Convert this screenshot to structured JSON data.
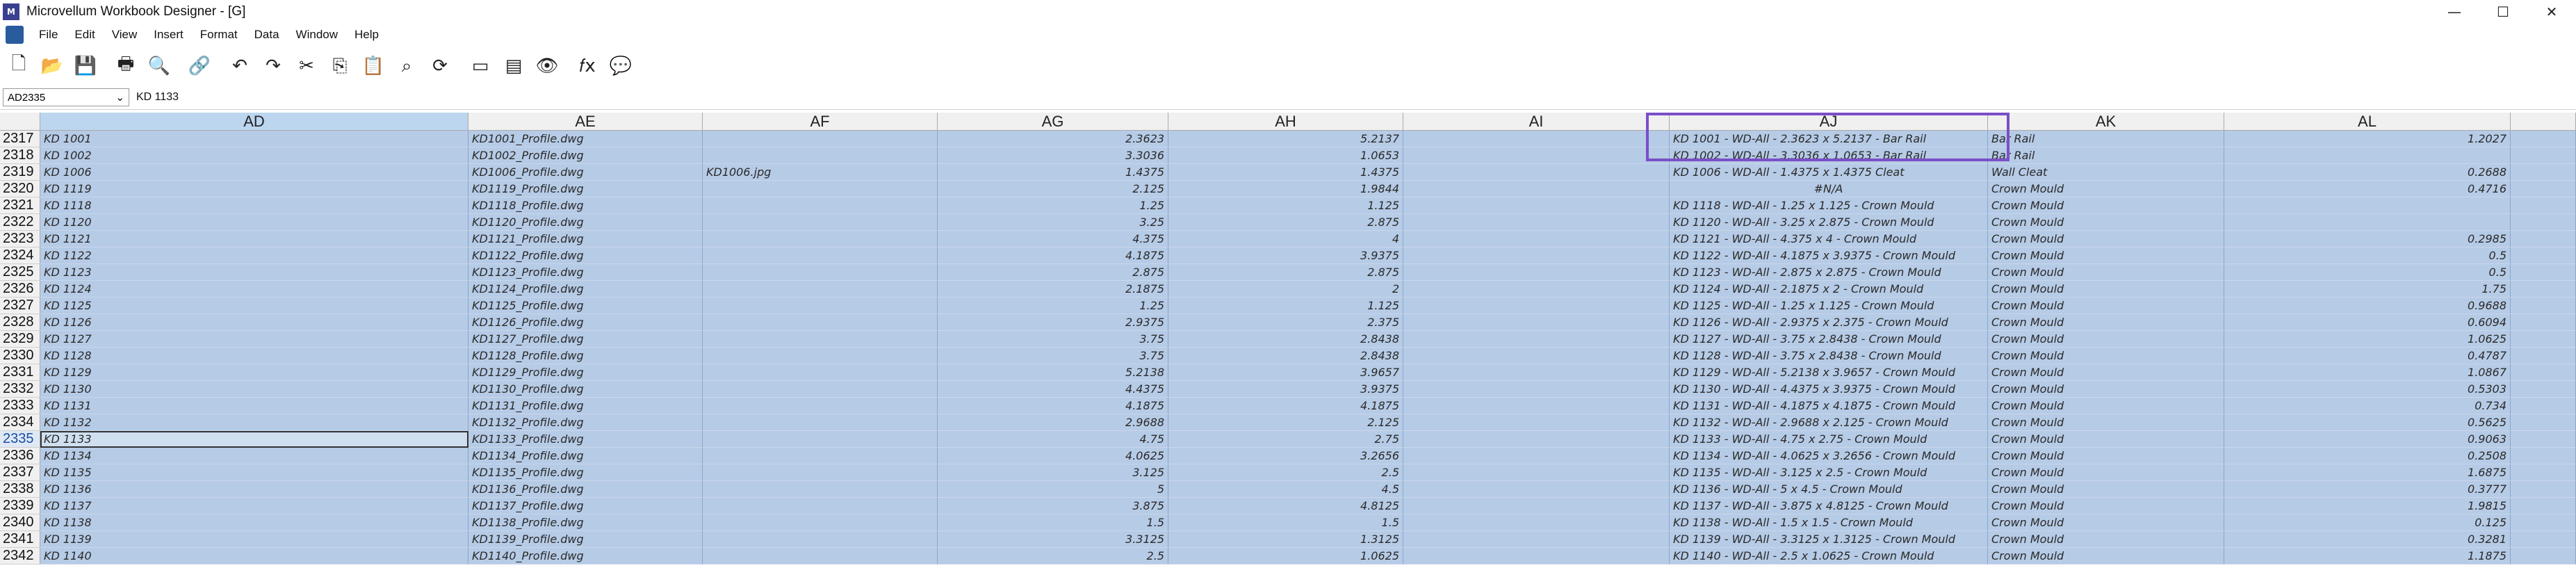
{
  "window": {
    "title": "Microvellum Workbook Designer - [G]",
    "minimize": "—",
    "maximize": "☐",
    "close": "✕"
  },
  "menu": [
    "File",
    "Edit",
    "View",
    "Insert",
    "Format",
    "Data",
    "Window",
    "Help"
  ],
  "toolbar": {
    "icons": [
      "new-file-icon",
      "open-folder-icon",
      "save-icon",
      "print-icon",
      "print-preview-icon",
      "link-icon",
      "undo-icon",
      "redo-icon",
      "cut-icon",
      "copy-icon",
      "paste-icon",
      "find-icon",
      "refresh-icon",
      "window-icon",
      "layout-icon",
      "eye-icon",
      "function-icon",
      "comment-icon"
    ],
    "glyphs": [
      "🗋",
      "📂",
      "💾",
      "🖶",
      "🔍",
      "🔗",
      "↶",
      "↷",
      "✂",
      "⎘",
      "📋",
      "⌕",
      "⟳",
      "▭",
      "▤",
      "👁",
      "𝑓x",
      "💬"
    ]
  },
  "formula_bar": {
    "name_box": "AD2335",
    "dropdown": "⌄",
    "value": "KD 1133"
  },
  "columns": [
    "AD",
    "AE",
    "AF",
    "AG",
    "AH",
    "AI",
    "AJ",
    "AK",
    "AL",
    ""
  ],
  "selected_column": "AD",
  "active_row": "2335",
  "rows": [
    {
      "n": "2317",
      "AD": "KD 1001",
      "AE": "KD1001_Profile.dwg",
      "AF": "",
      "AG": "2.3623",
      "AH": "5.2137",
      "AI": "",
      "AJ": "KD 1001 - WD-All - 2.3623 x 5.2137 - Bar Rail",
      "AK": "Bar Rail",
      "AL": "1.2027"
    },
    {
      "n": "2318",
      "AD": "KD 1002",
      "AE": "KD1002_Profile.dwg",
      "AF": "",
      "AG": "3.3036",
      "AH": "1.0653",
      "AI": "",
      "AJ": "KD 1002 - WD-All - 3.3036 x 1.0653 - Bar Rail",
      "AK": "Bar Rail",
      "AL": ""
    },
    {
      "n": "2319",
      "AD": "KD 1006",
      "AE": "KD1006_Profile.dwg",
      "AF": "KD1006.jpg",
      "AG": "1.4375",
      "AH": "1.4375",
      "AI": "",
      "AJ": "KD 1006 - WD-All - 1.4375 x 1.4375 Cleat",
      "AK": "Wall Cleat",
      "AL": "0.2688"
    },
    {
      "n": "2320",
      "AD": "KD 1119",
      "AE": "KD1119_Profile.dwg",
      "AF": "",
      "AG": "2.125",
      "AH": "1.9844",
      "AI": "",
      "AJ": "#N/A",
      "AK": "Crown Mould",
      "AL": "0.4716"
    },
    {
      "n": "2321",
      "AD": "KD 1118",
      "AE": "KD1118_Profile.dwg",
      "AF": "",
      "AG": "1.25",
      "AH": "1.125",
      "AI": "",
      "AJ": "KD 1118 - WD-All - 1.25 x 1.125 - Crown Mould",
      "AK": "Crown Mould",
      "AL": ""
    },
    {
      "n": "2322",
      "AD": "KD 1120",
      "AE": "KD1120_Profile.dwg",
      "AF": "",
      "AG": "3.25",
      "AH": "2.875",
      "AI": "",
      "AJ": "KD 1120 - WD-All - 3.25 x 2.875 - Crown Mould",
      "AK": "Crown Mould",
      "AL": ""
    },
    {
      "n": "2323",
      "AD": "KD 1121",
      "AE": "KD1121_Profile.dwg",
      "AF": "",
      "AG": "4.375",
      "AH": "4",
      "AI": "",
      "AJ": "KD 1121 - WD-All - 4.375 x 4 - Crown Mould",
      "AK": "Crown Mould",
      "AL": "0.2985"
    },
    {
      "n": "2324",
      "AD": "KD 1122",
      "AE": "KD1122_Profile.dwg",
      "AF": "",
      "AG": "4.1875",
      "AH": "3.9375",
      "AI": "",
      "AJ": "KD 1122 - WD-All - 4.1875 x 3.9375 - Crown Mould",
      "AK": "Crown Mould",
      "AL": "0.5"
    },
    {
      "n": "2325",
      "AD": "KD 1123",
      "AE": "KD1123_Profile.dwg",
      "AF": "",
      "AG": "2.875",
      "AH": "2.875",
      "AI": "",
      "AJ": "KD 1123 - WD-All - 2.875 x 2.875 - Crown Mould",
      "AK": "Crown Mould",
      "AL": "0.5"
    },
    {
      "n": "2326",
      "AD": "KD 1124",
      "AE": "KD1124_Profile.dwg",
      "AF": "",
      "AG": "2.1875",
      "AH": "2",
      "AI": "",
      "AJ": "KD 1124 - WD-All - 2.1875 x 2 - Crown Mould",
      "AK": "Crown Mould",
      "AL": "1.75"
    },
    {
      "n": "2327",
      "AD": "KD 1125",
      "AE": "KD1125_Profile.dwg",
      "AF": "",
      "AG": "1.25",
      "AH": "1.125",
      "AI": "",
      "AJ": "KD 1125 - WD-All - 1.25 x 1.125 - Crown Mould",
      "AK": "Crown Mould",
      "AL": "0.9688"
    },
    {
      "n": "2328",
      "AD": "KD 1126",
      "AE": "KD1126_Profile.dwg",
      "AF": "",
      "AG": "2.9375",
      "AH": "2.375",
      "AI": "",
      "AJ": "KD 1126 - WD-All - 2.9375 x 2.375 - Crown Mould",
      "AK": "Crown Mould",
      "AL": "0.6094"
    },
    {
      "n": "2329",
      "AD": "KD 1127",
      "AE": "KD1127_Profile.dwg",
      "AF": "",
      "AG": "3.75",
      "AH": "2.8438",
      "AI": "",
      "AJ": "KD 1127 - WD-All - 3.75 x 2.8438 - Crown Mould",
      "AK": "Crown Mould",
      "AL": "1.0625"
    },
    {
      "n": "2330",
      "AD": "KD 1128",
      "AE": "KD1128_Profile.dwg",
      "AF": "",
      "AG": "3.75",
      "AH": "2.8438",
      "AI": "",
      "AJ": "KD 1128 - WD-All - 3.75 x 2.8438 - Crown Mould",
      "AK": "Crown Mould",
      "AL": "0.4787"
    },
    {
      "n": "2331",
      "AD": "KD 1129",
      "AE": "KD1129_Profile.dwg",
      "AF": "",
      "AG": "5.2138",
      "AH": "3.9657",
      "AI": "",
      "AJ": "KD 1129 - WD-All - 5.2138 x 3.9657 - Crown Mould",
      "AK": "Crown Mould",
      "AL": "1.0867"
    },
    {
      "n": "2332",
      "AD": "KD 1130",
      "AE": "KD1130_Profile.dwg",
      "AF": "",
      "AG": "4.4375",
      "AH": "3.9375",
      "AI": "",
      "AJ": "KD 1130 - WD-All - 4.4375 x 3.9375 - Crown Mould",
      "AK": "Crown Mould",
      "AL": "0.5303"
    },
    {
      "n": "2333",
      "AD": "KD 1131",
      "AE": "KD1131_Profile.dwg",
      "AF": "",
      "AG": "4.1875",
      "AH": "4.1875",
      "AI": "",
      "AJ": "KD 1131 - WD-All - 4.1875 x 4.1875 - Crown Mould",
      "AK": "Crown Mould",
      "AL": "0.734"
    },
    {
      "n": "2334",
      "AD": "KD 1132",
      "AE": "KD1132_Profile.dwg",
      "AF": "",
      "AG": "2.9688",
      "AH": "2.125",
      "AI": "",
      "AJ": "KD 1132 - WD-All - 2.9688 x 2.125 - Crown Mould",
      "AK": "Crown Mould",
      "AL": "0.5625"
    },
    {
      "n": "2335",
      "AD": "KD 1133",
      "AE": "KD1133_Profile.dwg",
      "AF": "",
      "AG": "4.75",
      "AH": "2.75",
      "AI": "",
      "AJ": "KD 1133 - WD-All - 4.75 x 2.75 - Crown Mould",
      "AK": "Crown Mould",
      "AL": "0.9063"
    },
    {
      "n": "2336",
      "AD": "KD 1134",
      "AE": "KD1134_Profile.dwg",
      "AF": "",
      "AG": "4.0625",
      "AH": "3.2656",
      "AI": "",
      "AJ": "KD 1134 - WD-All - 4.0625 x 3.2656 - Crown Mould",
      "AK": "Crown Mould",
      "AL": "0.2508"
    },
    {
      "n": "2337",
      "AD": "KD 1135",
      "AE": "KD1135_Profile.dwg",
      "AF": "",
      "AG": "3.125",
      "AH": "2.5",
      "AI": "",
      "AJ": "KD 1135 - WD-All - 3.125 x 2.5 - Crown Mould",
      "AK": "Crown Mould",
      "AL": "1.6875"
    },
    {
      "n": "2338",
      "AD": "KD 1136",
      "AE": "KD1136_Profile.dwg",
      "AF": "",
      "AG": "5",
      "AH": "4.5",
      "AI": "",
      "AJ": "KD 1136 - WD-All - 5 x 4.5 - Crown Mould",
      "AK": "Crown Mould",
      "AL": "0.3777"
    },
    {
      "n": "2339",
      "AD": "KD 1137",
      "AE": "KD1137_Profile.dwg",
      "AF": "",
      "AG": "3.875",
      "AH": "4.8125",
      "AI": "",
      "AJ": "KD 1137 - WD-All - 3.875 x 4.8125 - Crown Mould",
      "AK": "Crown Mould",
      "AL": "1.9815"
    },
    {
      "n": "2340",
      "AD": "KD 1138",
      "AE": "KD1138_Profile.dwg",
      "AF": "",
      "AG": "1.5",
      "AH": "1.5",
      "AI": "",
      "AJ": "KD 1138 - WD-All - 1.5 x 1.5 - Crown Mould",
      "AK": "Crown Mould",
      "AL": "0.125"
    },
    {
      "n": "2341",
      "AD": "KD 1139",
      "AE": "KD1139_Profile.dwg",
      "AF": "",
      "AG": "3.3125",
      "AH": "1.3125",
      "AI": "",
      "AJ": "KD 1139 - WD-All - 3.3125 x 1.3125 - Crown Mould",
      "AK": "Crown Mould",
      "AL": "0.3281"
    },
    {
      "n": "2342",
      "AD": "KD 1140",
      "AE": "KD1140_Profile.dwg",
      "AF": "",
      "AG": "2.5",
      "AH": "1.0625",
      "AI": "",
      "AJ": "KD 1140 - WD-All - 2.5 x 1.0625 - Crown Mould",
      "AK": "Crown Mould",
      "AL": "1.1875"
    }
  ]
}
